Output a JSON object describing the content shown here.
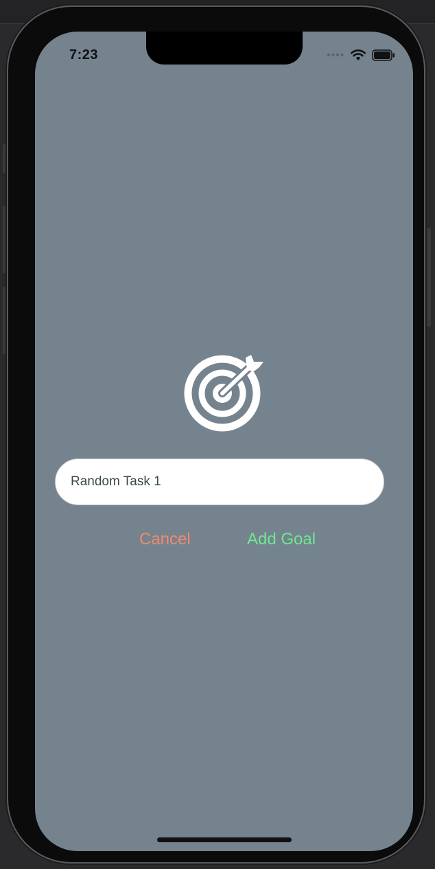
{
  "status_bar": {
    "time": "7:23",
    "icons": [
      "signal-dots-icon",
      "wifi-icon",
      "battery-icon"
    ]
  },
  "goal_icon": "target-arrow-icon",
  "goal_input": {
    "value": "Random Task 1",
    "placeholder": ""
  },
  "actions": {
    "cancel_label": "Cancel",
    "add_label": "Add Goal"
  },
  "colors": {
    "background": "#75838f",
    "cancel": "#f28a6b",
    "add": "#6ee88f",
    "input_bg": "#ffffff"
  }
}
